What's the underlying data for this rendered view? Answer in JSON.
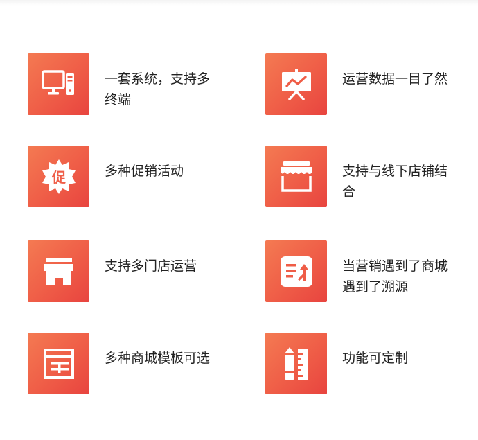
{
  "accent_gradient": [
    "#f47a52",
    "#e8443f"
  ],
  "features": [
    {
      "label": "一套系统，支持多终端",
      "icon": "computer-icon"
    },
    {
      "label": "运营数据一目了然",
      "icon": "presentation-chart-icon"
    },
    {
      "label": "多种促销活动",
      "icon": "promotion-badge-icon"
    },
    {
      "label": "支持与线下店铺结合",
      "icon": "storefront-awning-icon"
    },
    {
      "label": "支持多门店运营",
      "icon": "store-icon"
    },
    {
      "label": "当营销遇到了商城遇到了溯源",
      "icon": "list-upload-icon"
    },
    {
      "label": "多种商城模板可选",
      "icon": "template-layout-icon"
    },
    {
      "label": "功能可定制",
      "icon": "pencil-ruler-icon"
    }
  ]
}
